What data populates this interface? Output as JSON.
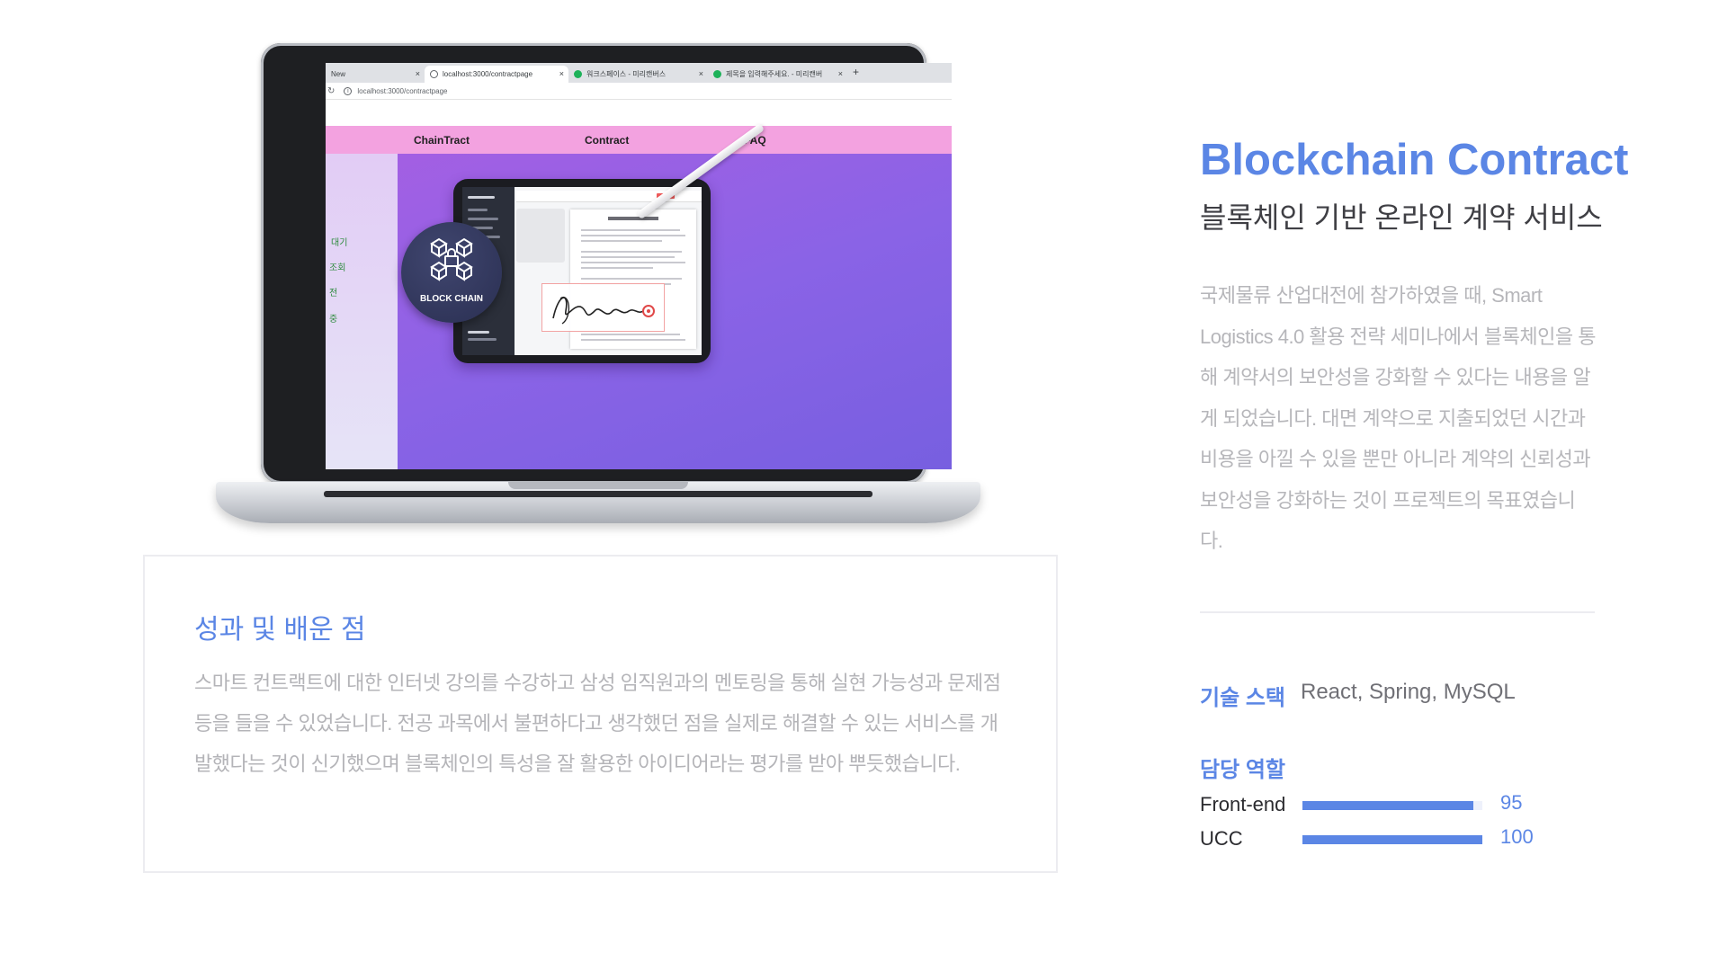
{
  "browser": {
    "tabs": [
      {
        "label": "New",
        "close": "×"
      },
      {
        "label": "localhost:3000/contractpage",
        "close": "×"
      },
      {
        "label": "워크스페이스 - 미리캔버스",
        "close": "×"
      },
      {
        "label": "제목을 입력해주세요. - 미리캔버",
        "close": "×"
      }
    ],
    "new_tab": "+",
    "url": "localhost:3000/contractpage"
  },
  "site": {
    "nav": [
      "ChainTract",
      "Contract",
      "FAQ"
    ],
    "side_items": [
      "대기",
      "조회",
      "전",
      "중"
    ],
    "badge_label": "BLOCK CHAIN"
  },
  "project": {
    "title": "Blockchain Contract",
    "subtitle": "블록체인 기반 온라인 계약 서비스",
    "description": "국제물류 산업대전에 참가하였을 때, Smart Logistics 4.0 활용 전략 세미나에서 블록체인을 통해 계약서의 보안성을 강화할 수 있다는 내용을 알게 되었습니다. 대면 계약으로 지출되었던 시간과 비용을 아낄 수 있을 뿐만 아니라 계약의 신뢰성과 보안성을 강화하는 것이 프로젝트의 목표였습니다."
  },
  "lessons": {
    "heading": "성과 및 배운 점",
    "body": "스마트 컨트랙트에 대한 인터넷 강의를 수강하고 삼성 임직원과의 멘토링을 통해 실현 가능성과 문제점 등을 들을 수 있었습니다. 전공 과목에서 불편하다고 생각했던 점을 실제로 해결할 수 있는 서비스를 개발했다는 것이 신기했으며 블록체인의 특성을 잘 활용한 아이디어라는 평가를 받아 뿌듯했습니다."
  },
  "tech": {
    "label": "기술 스택",
    "value": "React, Spring, MySQL"
  },
  "roles": {
    "heading": "담당 역할",
    "items": [
      {
        "name": "Front-end",
        "value": "95",
        "percent": 95
      },
      {
        "name": "UCC",
        "value": "100",
        "percent": 100
      }
    ]
  },
  "colors": {
    "accent": "#5b86e5",
    "nav_pink": "#f3a2e0",
    "hero_purple": "#8a63e6"
  }
}
